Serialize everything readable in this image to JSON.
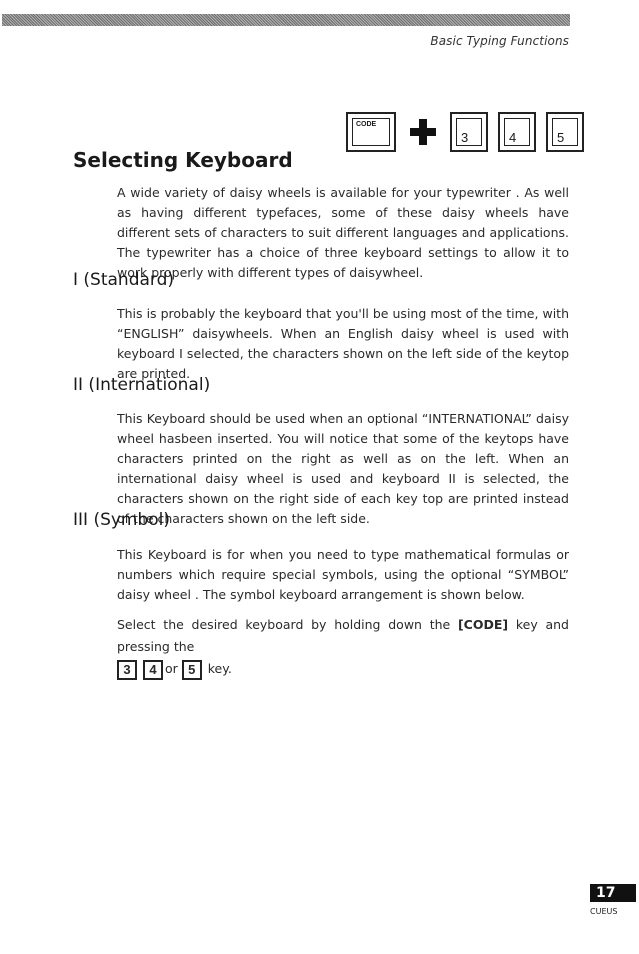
{
  "header": {
    "running_head": "Basic Typing Functions"
  },
  "key_combo": {
    "code_key": "CODE",
    "number_keys": [
      "3",
      "4",
      "5"
    ]
  },
  "title": "Selecting Keyboard",
  "intro": "A wide variety of daisy wheels is available for your typewriter . As well as having different typefaces, some of these daisy wheels have different sets of characters to suit different languages and applications. The typewriter has a choice of three keyboard settings to allow it to work properly with different types of daisywheel.",
  "sections": [
    {
      "heading": "I (Standard)",
      "body": "This is probably the keyboard that you'll be using most of the time, with “ENGLISH” daisywheels. When an English daisy wheel is used with keyboard I selected, the characters shown on the left side of the keytop are printed."
    },
    {
      "heading": "II (International)",
      "body": "This Keyboard should be used when an optional “INTERNATIONAL” daisy wheel hasbeen inserted. You will notice that some of the keytops have characters printed on the right as well as on the left. When an international daisy wheel is used and keyboard II is selected, the characters shown on the right side of each key top are printed instead of the characters shown on the left side."
    },
    {
      "heading": "III (Symbol)",
      "body": "This Keyboard is for when you need to type mathematical formulas or numbers which require special symbols, using the optional “SYMBOL” daisy wheel . The symbol keyboard arrangement is shown below."
    }
  ],
  "instruction": {
    "prefix": "Select the desired keyboard by holding down the ",
    "code_label": "[CODE]",
    "middle": " key and pressing the",
    "keys": [
      "3",
      "4",
      "5"
    ],
    "or_word": "or",
    "suffix": "key."
  },
  "footer": {
    "page_number": "17",
    "brand": "CUEUS"
  }
}
